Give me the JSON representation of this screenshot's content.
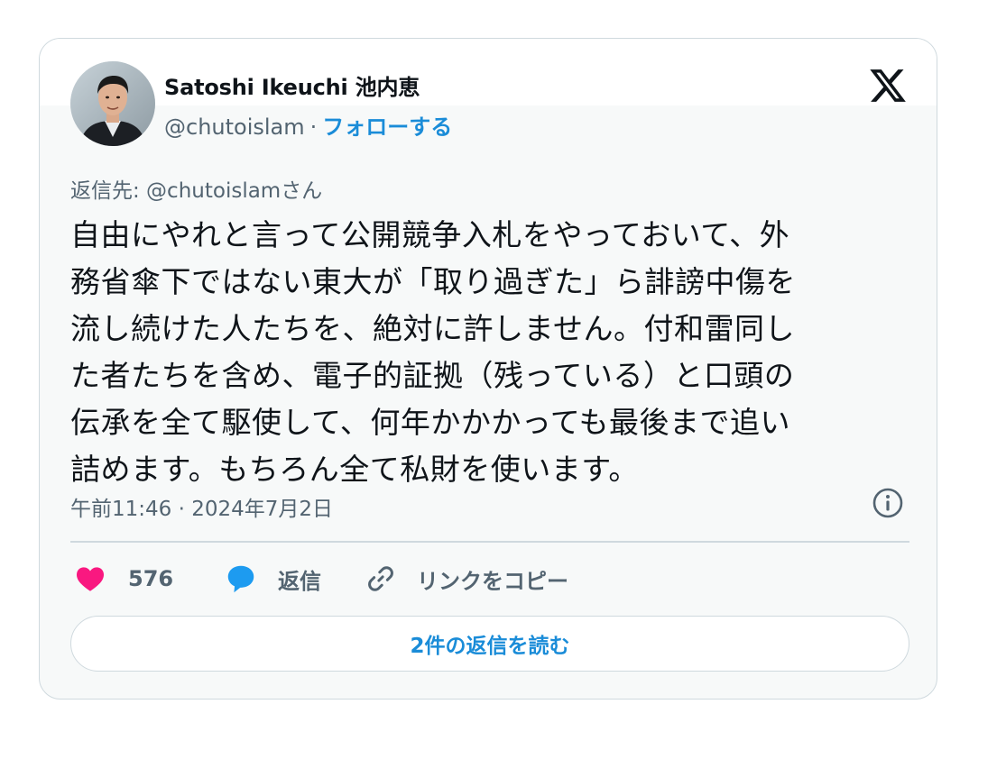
{
  "author": {
    "name": "Satoshi Ikeuchi 池内恵",
    "handle": "@chutoislam",
    "separator": "·",
    "follow_label": "フォローする"
  },
  "reply_to": "返信先: @chutoislamさん",
  "tweet_lines": [
    "自由にやれと言って公開競争入札をやっておいて、外",
    "務省傘下ではない東大が「取り過ぎた」ら誹謗中傷を",
    "流し続けた人たちを、絶対に許しません。付和雷同し",
    "た者たちを含め、電子的証拠（残っている）と口頭の",
    "伝承を全て駆使して、何年かかかっても最後まで追い",
    "詰めます。もちろん全て私財を使います。"
  ],
  "timestamp": "午前11:46 · 2024年7月2日",
  "actions": {
    "like_count": "576",
    "reply_label": "返信",
    "copy_link_label": "リンクをコピー"
  },
  "read_replies_label": "2件の返信を読む",
  "icons": {
    "like": "heart-icon",
    "reply": "speech-bubble-icon",
    "copy": "link-icon",
    "info": "info-icon",
    "brand": "x-logo-icon"
  },
  "colors": {
    "heart": "#f91880",
    "reply_bubble": "#1d9bf0",
    "link_text": "#1a8cd8",
    "secondary_text": "#536471",
    "border": "#cfd9de",
    "card_background": "#f7f9f9"
  }
}
